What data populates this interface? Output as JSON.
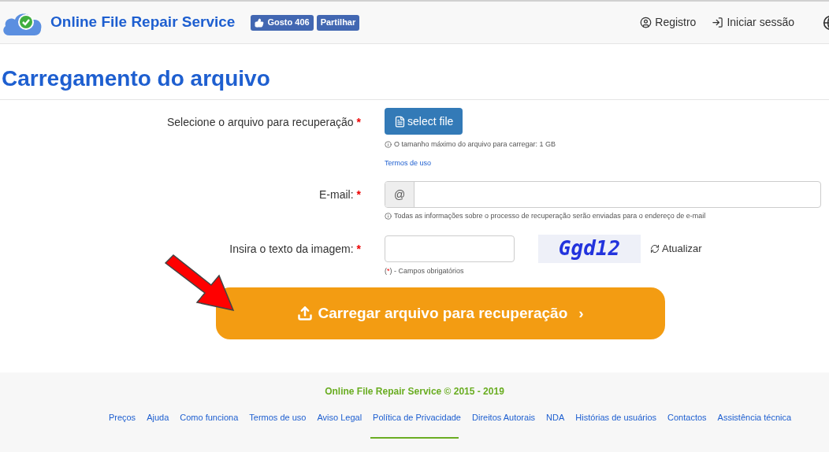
{
  "header": {
    "brand": "Online File Repair Service",
    "like_button": "Gosto 406",
    "share_button": "Partilhar",
    "nav": [
      "Registro",
      "Iniciar sessão"
    ]
  },
  "title": "Carregamento do arquivo",
  "form": {
    "file": {
      "label": "Selecione o arquivo para recuperação",
      "required_mark": "*",
      "button": "select file",
      "hint": "O tamanho máximo do arquivo para carregar: 1 GB",
      "terms_link": "Termos de uso"
    },
    "email": {
      "label": "E-mail:",
      "required_mark": "*",
      "addon": "@",
      "hint": "Todas as informações sobre o processo de recuperação serão enviadas para o endereço de e-mail"
    },
    "captcha": {
      "label": "Insira o texto da imagem:",
      "required_mark": "*",
      "captcha_text": "Ggd12",
      "refresh": "Atualizar",
      "note_open": "(",
      "note_mark": "*",
      "note_rest": ") - Campos obrigatórios"
    },
    "submit": {
      "label": "Carregar arquivo para recuperação",
      "chevron": "›"
    }
  },
  "footer": {
    "copyright": "Online File Repair Service © 2015 - 2019",
    "links": [
      "Preços",
      "Ajuda",
      "Como funciona",
      "Termos de uso",
      "Aviso Legal",
      "Política de Privacidade",
      "Direitos Autorais",
      "NDA",
      "Histórias de usuários",
      "Contactos",
      "Assistência técnica"
    ]
  }
}
